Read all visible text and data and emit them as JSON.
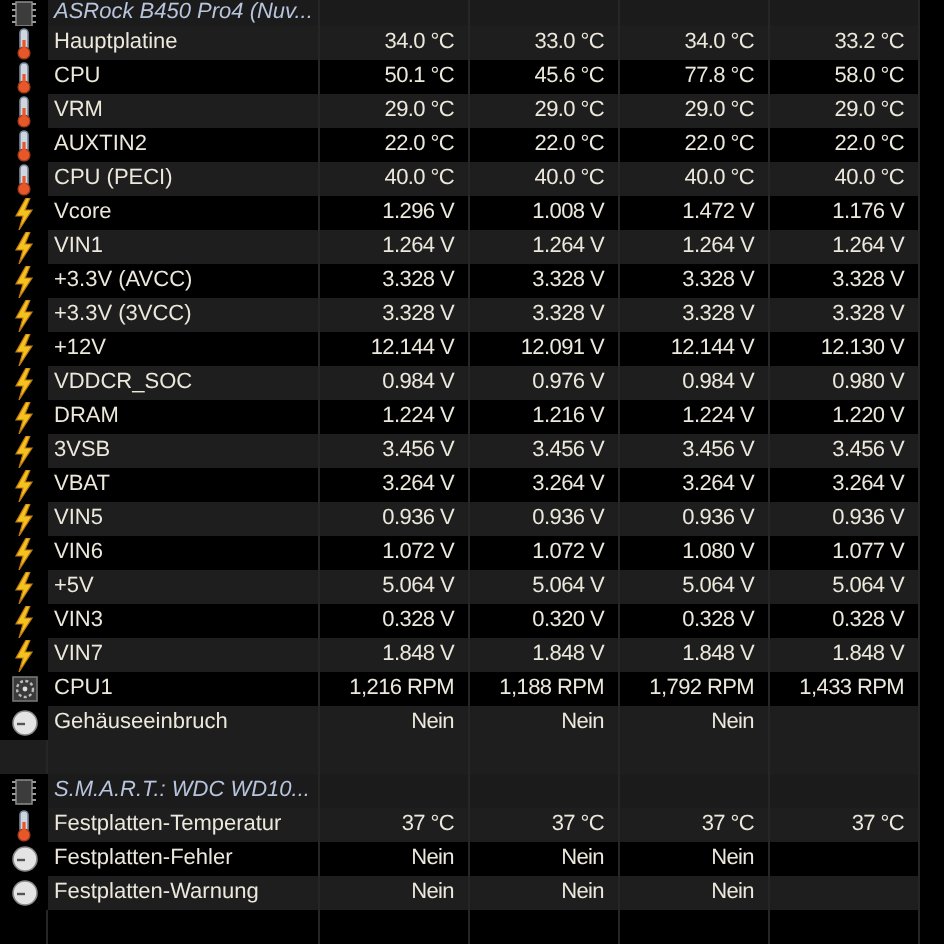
{
  "groups": [
    {
      "title": "ASRock B450 Pro4 (Nuv...",
      "rows": [
        {
          "kind": "temp",
          "label": "Hauptplatine",
          "values": [
            "34.0 °C",
            "33.0 °C",
            "34.0 °C",
            "33.2 °C"
          ]
        },
        {
          "kind": "temp",
          "label": "CPU",
          "values": [
            "50.1 °C",
            "45.6 °C",
            "77.8 °C",
            "58.0 °C"
          ]
        },
        {
          "kind": "temp",
          "label": "VRM",
          "values": [
            "29.0 °C",
            "29.0 °C",
            "29.0 °C",
            "29.0 °C"
          ]
        },
        {
          "kind": "temp",
          "label": "AUXTIN2",
          "values": [
            "22.0 °C",
            "22.0 °C",
            "22.0 °C",
            "22.0 °C"
          ]
        },
        {
          "kind": "temp",
          "label": "CPU (PECI)",
          "values": [
            "40.0 °C",
            "40.0 °C",
            "40.0 °C",
            "40.0 °C"
          ]
        },
        {
          "kind": "volt",
          "label": "Vcore",
          "values": [
            "1.296 V",
            "1.008 V",
            "1.472 V",
            "1.176 V"
          ]
        },
        {
          "kind": "volt",
          "label": "VIN1",
          "values": [
            "1.264 V",
            "1.264 V",
            "1.264 V",
            "1.264 V"
          ]
        },
        {
          "kind": "volt",
          "label": "+3.3V (AVCC)",
          "values": [
            "3.328 V",
            "3.328 V",
            "3.328 V",
            "3.328 V"
          ]
        },
        {
          "kind": "volt",
          "label": "+3.3V (3VCC)",
          "values": [
            "3.328 V",
            "3.328 V",
            "3.328 V",
            "3.328 V"
          ]
        },
        {
          "kind": "volt",
          "label": "+12V",
          "values": [
            "12.144 V",
            "12.091 V",
            "12.144 V",
            "12.130 V"
          ]
        },
        {
          "kind": "volt",
          "label": "VDDCR_SOC",
          "values": [
            "0.984 V",
            "0.976 V",
            "0.984 V",
            "0.980 V"
          ]
        },
        {
          "kind": "volt",
          "label": "DRAM",
          "values": [
            "1.224 V",
            "1.216 V",
            "1.224 V",
            "1.220 V"
          ]
        },
        {
          "kind": "volt",
          "label": "3VSB",
          "values": [
            "3.456 V",
            "3.456 V",
            "3.456 V",
            "3.456 V"
          ]
        },
        {
          "kind": "volt",
          "label": "VBAT",
          "values": [
            "3.264 V",
            "3.264 V",
            "3.264 V",
            "3.264 V"
          ]
        },
        {
          "kind": "volt",
          "label": "VIN5",
          "values": [
            "0.936 V",
            "0.936 V",
            "0.936 V",
            "0.936 V"
          ]
        },
        {
          "kind": "volt",
          "label": "VIN6",
          "values": [
            "1.072 V",
            "1.072 V",
            "1.080 V",
            "1.077 V"
          ]
        },
        {
          "kind": "volt",
          "label": "+5V",
          "values": [
            "5.064 V",
            "5.064 V",
            "5.064 V",
            "5.064 V"
          ]
        },
        {
          "kind": "volt",
          "label": "VIN3",
          "values": [
            "0.328 V",
            "0.320 V",
            "0.328 V",
            "0.328 V"
          ]
        },
        {
          "kind": "volt",
          "label": "VIN7",
          "values": [
            "1.848 V",
            "1.848 V",
            "1.848 V",
            "1.848 V"
          ]
        },
        {
          "kind": "fan",
          "label": "CPU1",
          "values": [
            "1,216 RPM",
            "1,188 RPM",
            "1,792 RPM",
            "1,433 RPM"
          ]
        },
        {
          "kind": "flag",
          "label": "Gehäuseeinbruch",
          "values": [
            "Nein",
            "Nein",
            "Nein"
          ]
        }
      ]
    },
    {
      "title": "S.M.A.R.T.: WDC WD10...",
      "rows": [
        {
          "kind": "temp",
          "label": "Festplatten-Temperatur",
          "values": [
            "37 °C",
            "37 °C",
            "37 °C",
            "37 °C"
          ]
        },
        {
          "kind": "flag",
          "label": "Festplatten-Fehler",
          "values": [
            "Nein",
            "Nein",
            "Nein"
          ]
        },
        {
          "kind": "flag",
          "label": "Festplatten-Warnung",
          "values": [
            "Nein",
            "Nein",
            "Nein"
          ]
        }
      ]
    }
  ]
}
